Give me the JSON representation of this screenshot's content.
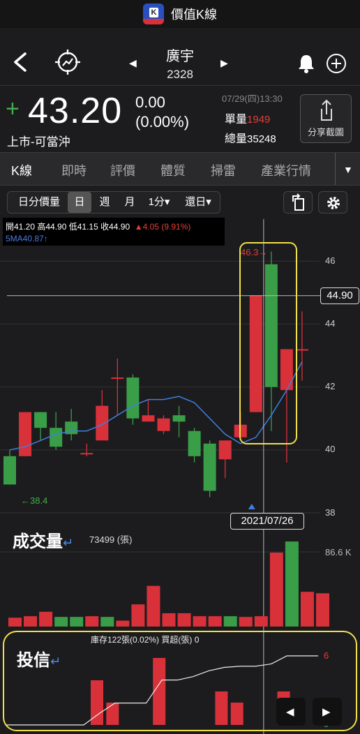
{
  "app": {
    "title": "價值K線"
  },
  "stock": {
    "name": "廣宇",
    "code": "2328"
  },
  "quote": {
    "price": "43.20",
    "change": "0.00",
    "change_pct": "(0.00%)",
    "market": "上市-可當沖",
    "time": "07/29(四)13:30",
    "single_vol_label": "單量",
    "single_vol": "1949",
    "total_vol_label": "總量",
    "total_vol": "35248",
    "share_label": "分享截圖"
  },
  "tabs": [
    "K線",
    "即時",
    "評價",
    "體質",
    "掃雷",
    "產業行情"
  ],
  "periods": [
    "日分價量",
    "日",
    "週",
    "月",
    "1分▾",
    "還日▾"
  ],
  "ohlc": {
    "line1_prefix": "開41.20  高44.90  低41.15  收44.90",
    "line1_change": "▲4.05 (9.91%)",
    "ma": "5MA40.87↑"
  },
  "crosshair": {
    "price": "44.90",
    "date": "2021/07/26"
  },
  "annotations": {
    "high": "46.3→",
    "low": "←38.4"
  },
  "volume": {
    "title": "成交量",
    "count": "73499 (張)",
    "scale": "86.6 K"
  },
  "institution": {
    "title": "投信",
    "info": "庫存122張(0.02%)  買超(張) 0",
    "max": "6",
    "min": "0"
  },
  "chart_data": [
    {
      "type": "candlestick",
      "ylim": [
        37.6,
        46.9
      ],
      "y_ticks": [
        38,
        40,
        42,
        44,
        46
      ],
      "candles": [
        {
          "o": 39.8,
          "h": 40.0,
          "l": 38.9,
          "c": 38.9
        },
        {
          "o": 39.8,
          "h": 41.0,
          "l": 39.8,
          "c": 41.2
        },
        {
          "o": 41.2,
          "h": 41.0,
          "l": 40.3,
          "c": 40.7
        },
        {
          "o": 40.7,
          "h": 41.2,
          "l": 40.0,
          "c": 40.1
        },
        {
          "o": 40.9,
          "h": 41.3,
          "l": 40.3,
          "c": 40.5
        },
        {
          "o": 39.9,
          "h": 40.2,
          "l": 39.8,
          "c": 39.9
        },
        {
          "o": 40.3,
          "h": 41.9,
          "l": 40.3,
          "c": 41.4
        },
        {
          "o": 42.3,
          "h": 42.9,
          "l": 41.1,
          "c": 42.3
        },
        {
          "o": 42.3,
          "h": 42.4,
          "l": 40.8,
          "c": 41.0
        },
        {
          "o": 40.9,
          "h": 41.6,
          "l": 40.9,
          "c": 41.1
        },
        {
          "o": 40.6,
          "h": 41.1,
          "l": 40.5,
          "c": 41.0
        },
        {
          "o": 41.1,
          "h": 41.4,
          "l": 40.4,
          "c": 40.9
        },
        {
          "o": 40.6,
          "h": 40.7,
          "l": 39.6,
          "c": 39.8
        },
        {
          "o": 40.2,
          "h": 40.3,
          "l": 38.5,
          "c": 38.7
        },
        {
          "o": 39.7,
          "h": 40.3,
          "l": 39.1,
          "c": 40.3
        },
        {
          "o": 40.4,
          "h": 41.2,
          "l": 40.3,
          "c": 40.8
        },
        {
          "o": 41.2,
          "h": 44.9,
          "l": 41.2,
          "c": 44.9
        },
        {
          "o": 45.9,
          "h": 46.3,
          "l": 40.6,
          "c": 42.0
        },
        {
          "o": 41.9,
          "h": 43.2,
          "l": 39.6,
          "c": 43.2
        },
        {
          "o": 43.2,
          "h": 44.4,
          "l": 42.2,
          "c": 43.2
        }
      ],
      "ma5": [
        40.0,
        40.1,
        40.3,
        40.5,
        40.6,
        40.6,
        40.8,
        41.1,
        41.4,
        41.6,
        41.6,
        41.7,
        41.5,
        41.0,
        40.5,
        40.2,
        40.4,
        41.1,
        41.9,
        42.8
      ]
    },
    {
      "type": "bar",
      "title": "成交量",
      "scale_label": "86.6 K",
      "volumes": [
        12,
        14,
        20,
        13,
        13,
        14,
        13,
        8,
        30,
        55,
        18,
        18,
        14,
        14,
        14,
        13,
        14,
        100,
        115,
        47,
        45
      ]
    },
    {
      "type": "bar",
      "title": "投信",
      "buy": [
        0,
        0,
        0,
        0,
        0,
        0,
        4,
        2,
        0,
        0,
        6,
        0,
        0,
        0,
        3,
        2,
        0,
        0,
        3,
        0,
        0
      ],
      "inventory_line": [
        0,
        0,
        0,
        0,
        0,
        0,
        1.0,
        1.9,
        1.9,
        1.9,
        3.9,
        3.9,
        4.2,
        4.7,
        5.0,
        5.1,
        5.1,
        5.3,
        6.0,
        6.0,
        6.0
      ]
    }
  ],
  "colors": {
    "up": "#d8313a",
    "down": "#3a9e48",
    "ma": "#3d7ee0",
    "highlight": "#f0e04a"
  }
}
